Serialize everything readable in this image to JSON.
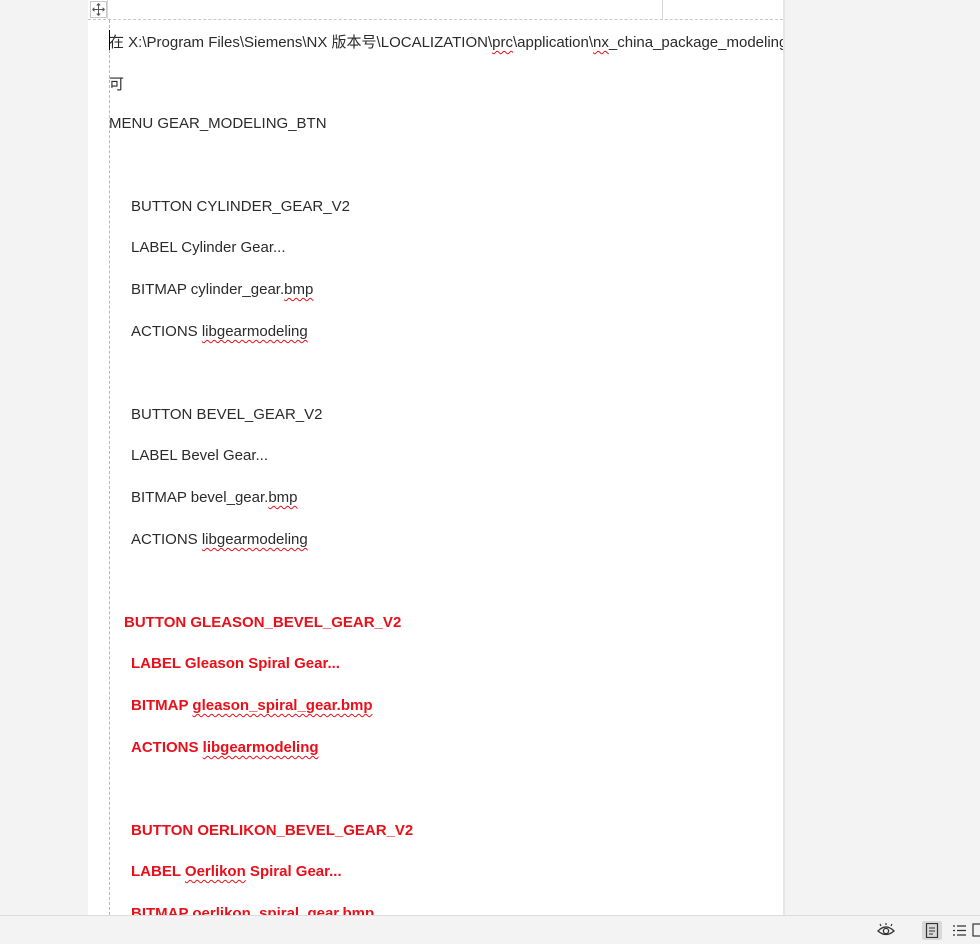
{
  "document": {
    "lines": {
      "path_prefix": "在 X:\\Program Files\\Siemens\\NX  版本号\\LOCALIZATION\\",
      "path_prc": "prc",
      "path_mid": "\\application\\",
      "path_nx": "nx",
      "path_suffix": "_china_package_modeling",
      "line_ke": "可",
      "menu": "MENU GEAR_MODELING_BTN",
      "b1_button": "BUTTON  CYLINDER_GEAR_V2",
      "b1_label": "LABEL Cylinder Gear...",
      "b1_bitmap_prefix": "BITMAP cylinder_gear.",
      "b1_bitmap_ext": "bmp",
      "b1_actions_prefix": "ACTIONS ",
      "b1_actions_lib": "libgearmodeling",
      "b2_button": "BUTTON  BEVEL_GEAR_V2",
      "b2_label": "LABEL Bevel Gear...",
      "b2_bitmap_prefix": "BITMAP bevel_gear.",
      "b2_bitmap_ext": "bmp",
      "b2_actions_prefix": "ACTIONS ",
      "b2_actions_lib": "libgearmodeling",
      "b3_button": "BUTTON GLEASON_BEVEL_GEAR_V2",
      "b3_label": "LABEL Gleason Spiral  Gear...",
      "b3_bitmap_prefix": "BITMAP ",
      "b3_bitmap_file": "gleason_spiral_gear.bmp",
      "b3_actions_prefix": "ACTIONS ",
      "b3_actions_lib": "libgearmodeling",
      "b4_button": "BUTTON OERLIKON_BEVEL_GEAR_V2",
      "b4_label_prefix": "LABEL ",
      "b4_label_word": "Oerlikon",
      "b4_label_suffix": " Spiral Gear...",
      "b4_bitmap": "BITMAP oerlikon_spiral_gear.bmp"
    }
  },
  "statusbar": {
    "icons": [
      "eye-protection-icon",
      "page-view-icon",
      "outline-view-icon",
      "web-layout-icon"
    ]
  },
  "colors": {
    "red_text": "#e8101a",
    "body_text": "#2b2b2b",
    "page_bg": "#ffffff",
    "app_bg": "#f3f3f3"
  }
}
